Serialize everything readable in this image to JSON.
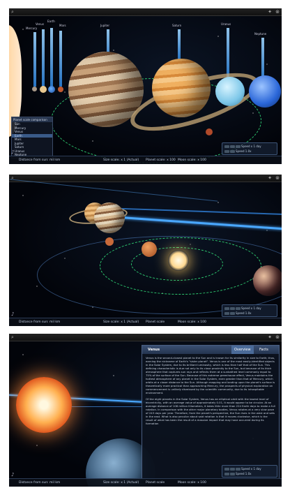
{
  "panels": [
    {
      "status": {
        "distance": "Distance from sun: mil km",
        "size_scale": "Size scale: x 1 (Actual)",
        "planet_scale": "Planet scale: x 100",
        "moon_scale": "Moon scale: x 100"
      },
      "planet_labels": [
        "Mercury",
        "Venus",
        "Earth",
        "Mars",
        "Jupiter",
        "Saturn",
        "Uranus",
        "Neptune"
      ],
      "menu": {
        "title": "Planet scale comparison",
        "items": [
          "Sun",
          "Mercury",
          "Venus",
          "Earth",
          "Mars",
          "Jupiter",
          "Saturn",
          "Uranus",
          "Neptune"
        ],
        "selected_index": 3
      },
      "controls": {
        "row1": "Speed x 1 day",
        "row2": "Speed 1.0x"
      }
    },
    {
      "status": {
        "distance": "Distance from sun: mil km",
        "size_scale": "Size scale: x 1 (Actual)",
        "planet_scale": "Planet scale",
        "moon_scale": "Moon scale: x 100"
      },
      "controls": {
        "row1": "Speed x 1 day",
        "row2": "Speed 1.0x"
      }
    },
    {
      "status": {
        "distance": "Distance from sun: mil km",
        "size_scale": "Size scale: x 1 (Actual)",
        "planet_scale": "Planet scale",
        "moon_scale": "Moon scale: x 100"
      },
      "info": {
        "title": "Venus",
        "tabs": [
          "Overview",
          "Facts"
        ],
        "paragraphs": [
          "Venus is the second-closest planet to the Sun and is known for its similarity in size to Earth; thus, earning the nickname of Earth's \"sister planet\". Venus is one of the most easily-identified objects in the Solar System, due to its brilliant luminosity, which is less than half that of the Sun. This defining characteristic is due not only to its close proximity to the Sun, but because of its thick atmosphere that captures sun rays and reflects them at a sunbathed level commonly equal to 75% of the surface of the Sun. Because of this extreme greenhouse effect, Venus maintains the hottest atmosphere of any planet in the Solar System, even greater than that of Mercury, which orbits at a closer distance to the Sun. Although mapping and landing upon the planet's surface is theoretically more practical than approaching Mercury, the prospects of physical exploration on commencement is unlikely dismissed by the scientific community, due to its inhospitable environment.",
          "Of the eight planets in the Solar System, Venus has an elliptical orbit with the lowest level of eccentricity, with an average value of approximately 0.01, it would appear to be circular. At an average distance of 108 million Kilometers, it takes little more than 224 Earth days to make a full rotation. In comparison with the other major planetary bodies, Venus rotates at a very slow pace of 243 days per year. Therefore, from the planet's perspective, the Sun rises in the west and sets in the east. What is also peculiar about said rotation is that it moves clockwise, which is the result of what has been the result of a massive impact that may have occurred during its formation"
        ]
      },
      "controls": {
        "row1": "Speed x 1 day",
        "row2": "Speed 1.0x"
      }
    }
  ],
  "colors": {
    "orbit": "#2ecc71",
    "pillar": "#5bb6ff",
    "panel_border": "#3d5578"
  }
}
